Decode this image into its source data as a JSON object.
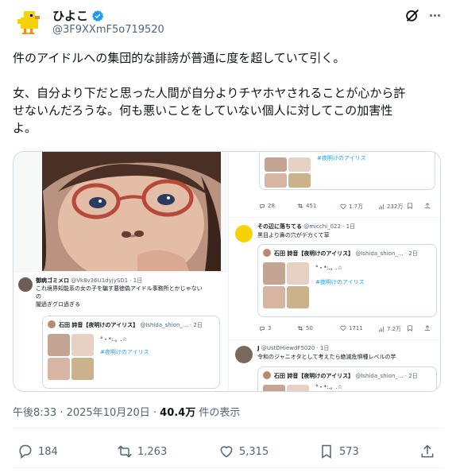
{
  "author": {
    "display_name": "ひよこ",
    "handle": "@3F9XXmF5o719520",
    "verified_icon": "verified-badge-icon"
  },
  "tweet": {
    "line1": "件のアイドルへの集団的な誹謗が普通に度を超していて引く。",
    "line2": "女、自分より下だと思った人間が自分よりチヤホヤされることが心から許",
    "line3": "せないんだろうな。何も悪いことをしていない個人に対してこの加害性",
    "line4": "よ。"
  },
  "media": {
    "left_post": {
      "name": "御病ゴミメロ",
      "handle": "@Vk8v36U1dyjySD1 · 1日",
      "body1": "これ境界知能系の女の子を騙す悪徳偽アイドル事務所とかじゃない",
      "body2": "の",
      "body3": "闇過ぎグロ過ぎる",
      "quote": {
        "name": "石田 詩音【夜明けのアイリス】",
        "handle": "@Ishida_shion_... · 2日",
        "symbols": "°・*:.。.☆",
        "tag": "#夜明けのアイリス"
      }
    },
    "right_top": {
      "tag": "#夜明けのアイリス",
      "metrics": [
        "28",
        "451",
        "1.7万",
        "232万"
      ]
    },
    "right_post1": {
      "name": "その辺に落ちてる",
      "handle": "@micchi_022 · 1日",
      "body": "黒目より鼻の穴がデカくて草",
      "quote": {
        "name": "石田 詩音【夜明けのアイリス】",
        "handle": "@Ishida_shion_... · 2日",
        "symbols": "°・*:.。.☆",
        "tag": "#夜明けのアイリス"
      },
      "metrics": [
        "3",
        "50",
        "1711",
        "7.2万"
      ]
    },
    "right_post2": {
      "name": "J",
      "handle": "@UstDHiewdF5020 · 1日",
      "body": "令和のジャニオタとして考えたら絶滅危惧種レベルの芋",
      "quote": {
        "name": "石田 詩音【夜明けのアイリス】",
        "handle": "@Ishida_shion_... · 2日",
        "symbols": "°・*:.。.☆"
      }
    }
  },
  "meta": {
    "time": "午後8:33 · 2025年10月20日 · ",
    "views_count": "40.4万",
    "views_label": " 件の表示"
  },
  "actions": {
    "replies": "184",
    "reposts": "1,263",
    "likes": "5,315",
    "bookmarks": "573"
  },
  "colors": {
    "accent": "#1d9bf0",
    "muted": "#536471",
    "text": "#0f1419",
    "border": "#cfd9de"
  }
}
